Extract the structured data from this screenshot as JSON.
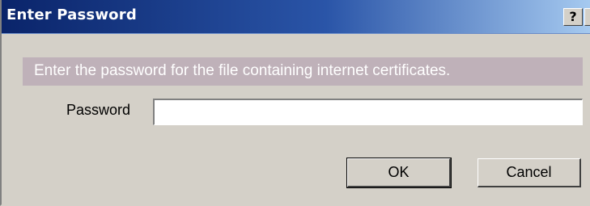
{
  "window": {
    "title": "Enter Password",
    "help_button": "?",
    "close_button": "✕"
  },
  "message": "Enter the password for the file containing internet certificates.",
  "password_field": {
    "label": "Password",
    "value": "",
    "placeholder": ""
  },
  "buttons": {
    "ok": "OK",
    "cancel": "Cancel"
  },
  "colors": {
    "titlebar_start": "#0a246a",
    "titlebar_end": "#a6caf0",
    "dialog_face": "#d4d0c8",
    "message_band": "#bfb1b9"
  }
}
